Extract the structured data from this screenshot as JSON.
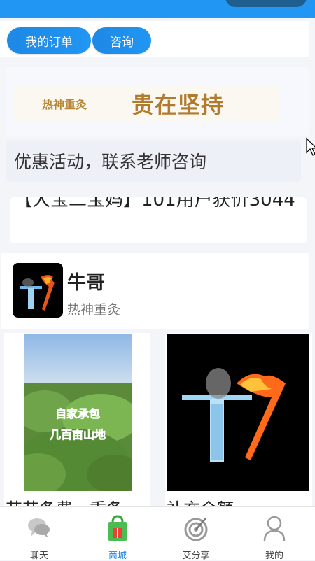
{
  "tabs": {
    "orders": "我的订单",
    "consult": "咨询"
  },
  "banner": {
    "small_text": "热神重灸",
    "big_text": "贵在坚持"
  },
  "notice": "优惠活动，联系老师咨询",
  "marquee": "【大宝二宝妈】101用户获价3044",
  "shop": {
    "name": "牛哥",
    "subtitle": "热神重灸"
  },
  "products": [
    {
      "title": "艾艾条费，重条",
      "photo_text_line1": "自家承包",
      "photo_text_line2": "几百亩山地"
    },
    {
      "title": "补充余额"
    }
  ],
  "tabbar": [
    {
      "label": "聊天",
      "icon": "chat-icon"
    },
    {
      "label": "商城",
      "icon": "shopping-bag-icon",
      "active": true
    },
    {
      "label": "艾分享",
      "icon": "target-icon"
    },
    {
      "label": "我的",
      "icon": "user-icon"
    }
  ],
  "colors": {
    "primary": "#2196f3",
    "active_tab": "#1e88e5",
    "banner_gold": "#b07a2f"
  }
}
